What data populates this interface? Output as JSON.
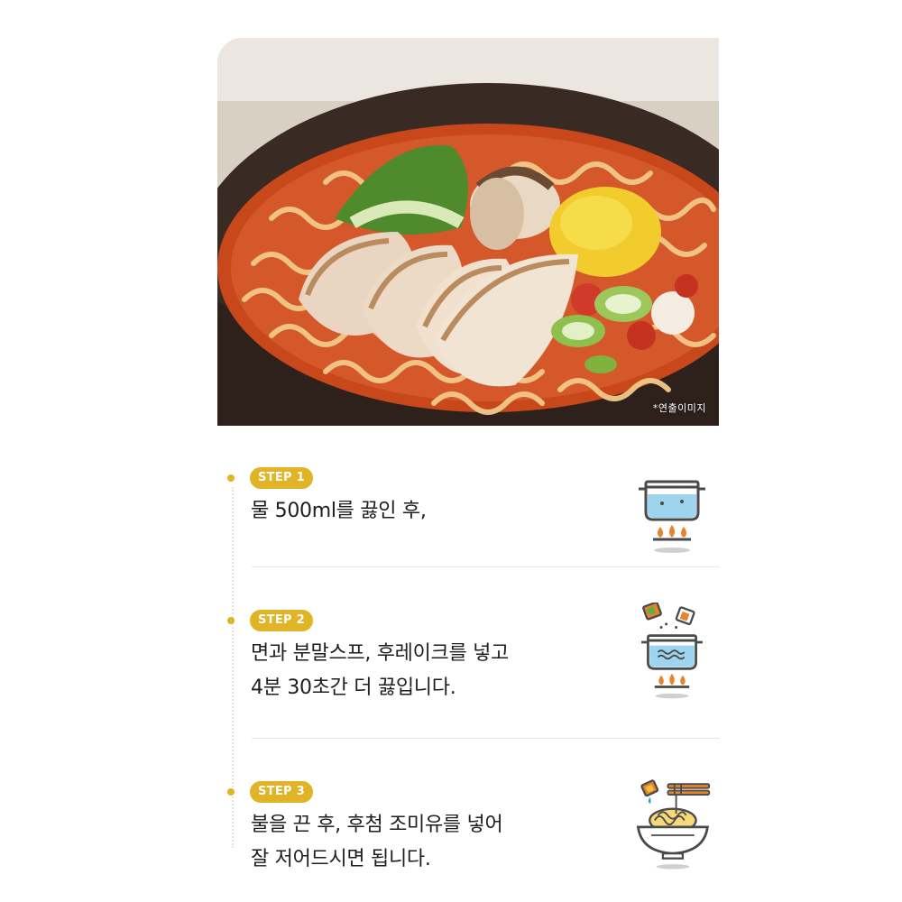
{
  "hero": {
    "caption": "*연출이미지"
  },
  "steps": [
    {
      "label": "STEP 1",
      "text": "물 500ml를 끓인 후,"
    },
    {
      "label": "STEP 2",
      "text": "면과 분말스프, 후레이크를 넣고\n4분 30초간 더 끓입니다."
    },
    {
      "label": "STEP 3",
      "text": "불을 끈 후, 후첨 조미유를 넣어\n잘 저어드시면 됩니다."
    }
  ],
  "icons": {
    "step1": "boiling-pot-icon",
    "step2": "pot-with-soup-packets-icon",
    "step3": "noodle-bowl-with-chopsticks-icon"
  },
  "colors": {
    "accent": "#e1b326",
    "text": "#1e1e1e",
    "divider": "#e6e6e6",
    "icon_water": "#7fc4e8",
    "icon_flame": "#e8832a"
  }
}
